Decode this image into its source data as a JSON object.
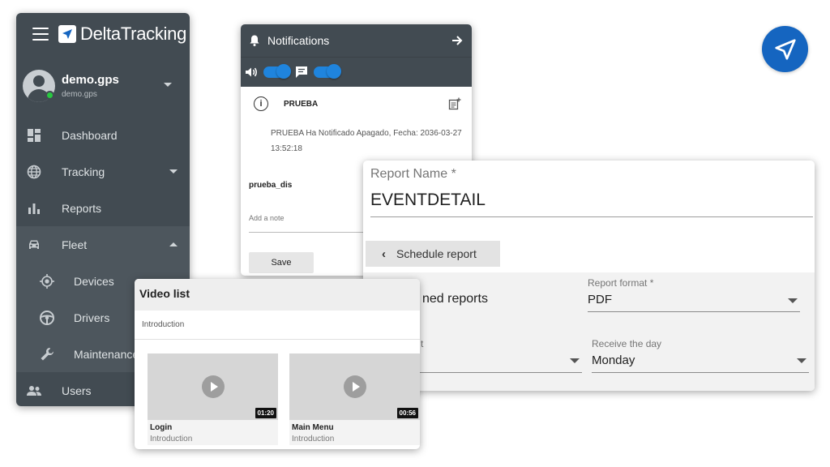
{
  "colors": {
    "accent": "#1e88e5",
    "sidebar_bg": "#424b52",
    "fab_bg": "#1565c0",
    "online": "#28c840"
  },
  "sidebar": {
    "brand": "DeltaTracking",
    "user": {
      "name": "demo.gps",
      "subtitle": "demo.gps"
    },
    "items": [
      {
        "label": "Dashboard",
        "icon": "dashboard-icon"
      },
      {
        "label": "Tracking",
        "icon": "globe-icon"
      },
      {
        "label": "Reports",
        "icon": "bar-chart-icon"
      },
      {
        "label": "Fleet",
        "icon": "car-icon"
      },
      {
        "label": "Devices",
        "icon": "gps-target-icon"
      },
      {
        "label": "Drivers",
        "icon": "steering-wheel-icon"
      },
      {
        "label": "Maintenance",
        "icon": "wrench-icon"
      },
      {
        "label": "Users",
        "icon": "users-icon"
      }
    ]
  },
  "notifications": {
    "title": "Notifications",
    "entry_title": "PRUEBA",
    "entry_text": "PRUEBA Ha Notificado Apagado, Fecha: 2036-03-27 13:52:18",
    "device_label": "prueba_dis",
    "note_placeholder": "Add a note",
    "save_label": "Save",
    "sound_enabled": true,
    "message_enabled": true
  },
  "report": {
    "name_label": "Report Name *",
    "name_value": "EVENTDETAIL",
    "schedule_button": "Schedule report",
    "planned_label": "ned reports",
    "format_label": "Report format *",
    "format_value": "PDF",
    "partial_label": "t",
    "receive_label": "Receive the day",
    "receive_value": "Monday"
  },
  "videos": {
    "title": "Video list",
    "category": "Introduction",
    "items": [
      {
        "title": "Login",
        "subtitle": "Introduction",
        "duration": "01:20"
      },
      {
        "title": "Main Menu",
        "subtitle": "Introduction",
        "duration": "00:56"
      }
    ]
  }
}
